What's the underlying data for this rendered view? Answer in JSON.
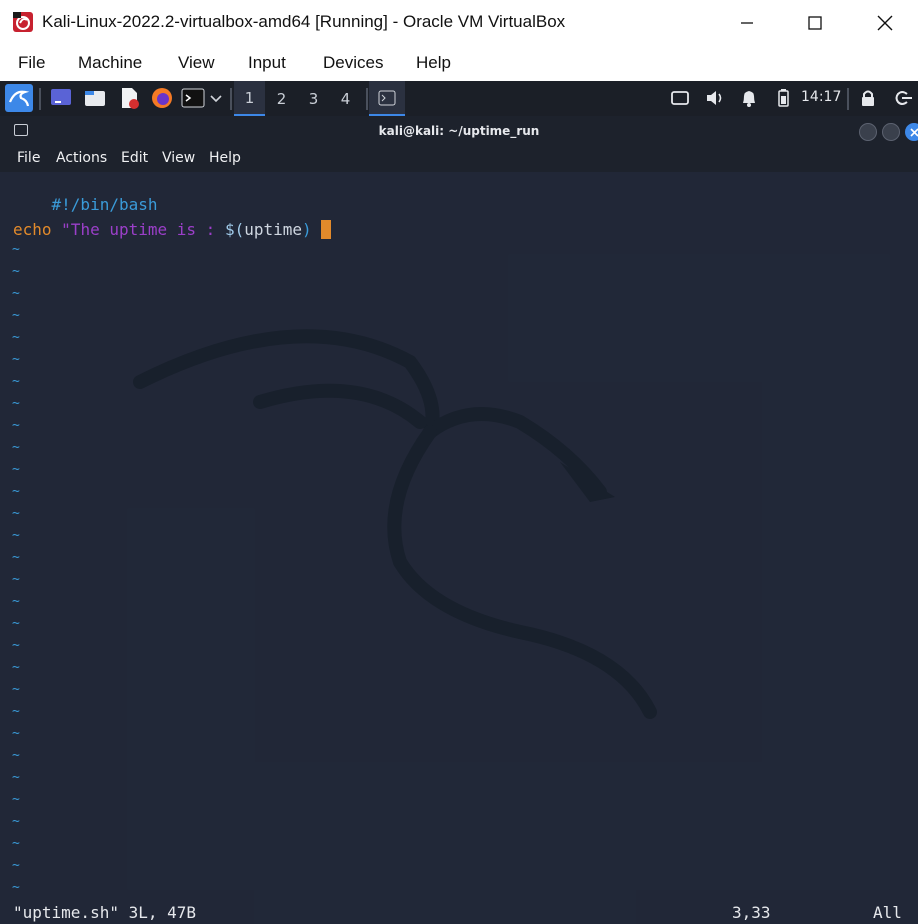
{
  "host_window": {
    "title": "Kali-Linux-2022.2-virtualbox-amd64 [Running] - Oracle VM VirtualBox",
    "menu": [
      "File",
      "Machine",
      "View",
      "Input",
      "Devices",
      "Help"
    ]
  },
  "panel": {
    "workspaces": [
      "1",
      "2",
      "3",
      "4"
    ],
    "active_workspace": "1",
    "clock": "14:17"
  },
  "terminal": {
    "title": "kali@kali: ~/uptime_run",
    "menu": [
      "File",
      "Actions",
      "Edit",
      "View",
      "Help"
    ]
  },
  "editor": {
    "shebang": "#!/bin/bash",
    "line2": {
      "command": "echo",
      "string_open": "\"The uptime is : ",
      "subst_start": "$(",
      "subst_cmd": "uptime",
      "subst_end": ")",
      "space": " ",
      "closing_quote": "\""
    },
    "empty_line_marker": "~",
    "status_file": "\"uptime.sh\" 3L, 47B",
    "cursor_pos": "3,33",
    "scroll_pos": "All"
  },
  "colors": {
    "shebang": "#3a9bd9",
    "command": "#e28a2b",
    "string": "#9b3fc9",
    "subst": "#3a9bd9",
    "accent": "#3d88e8"
  }
}
